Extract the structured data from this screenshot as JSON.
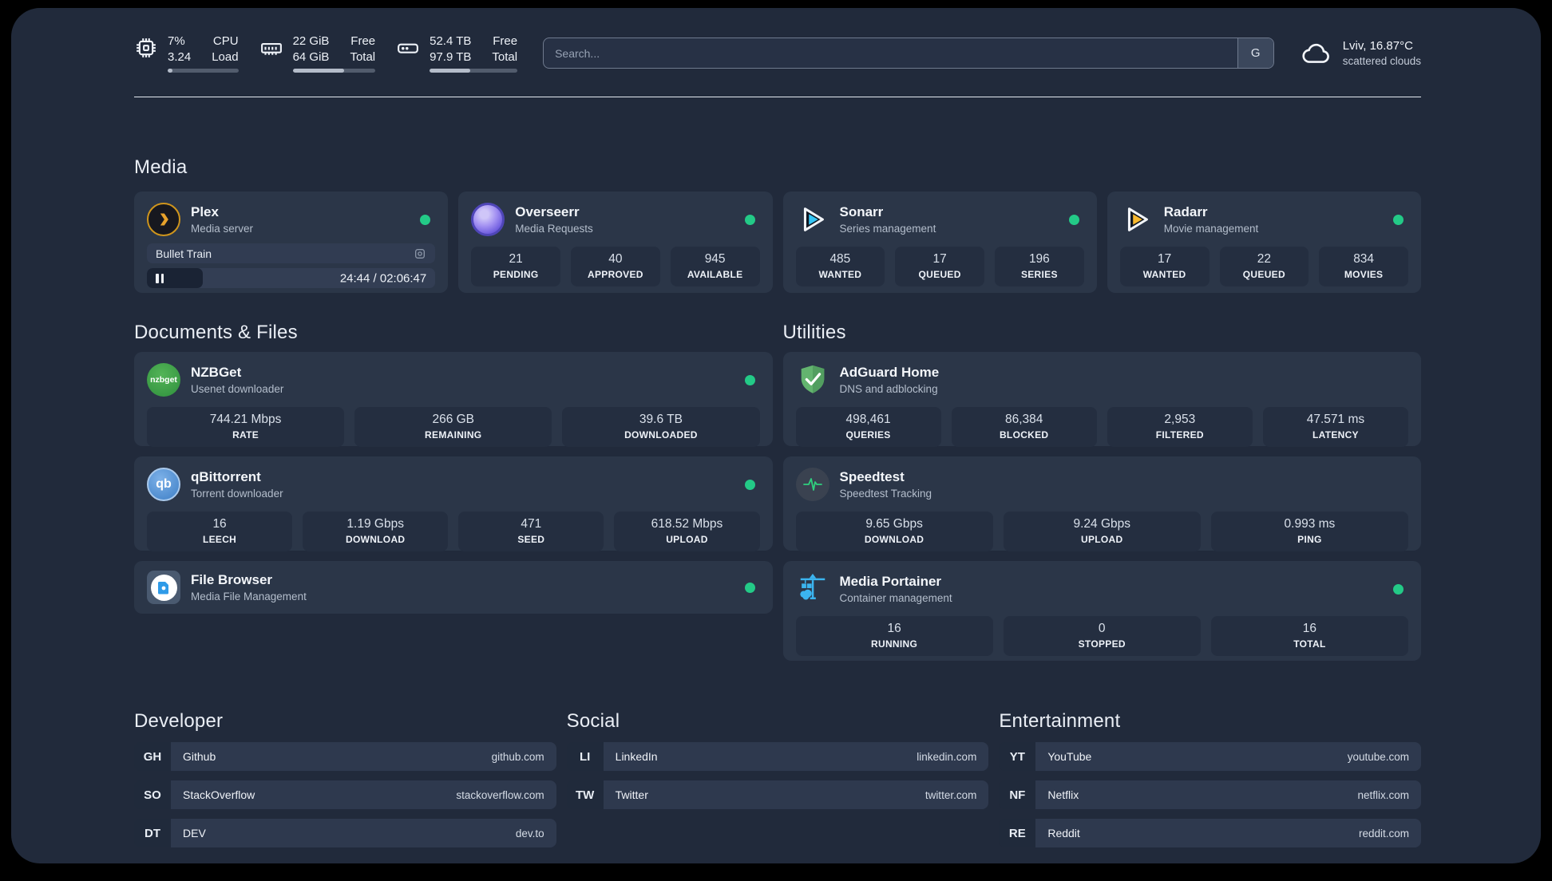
{
  "colors": {
    "status_online": "#23ca87",
    "background": "#212a3b",
    "card": "#2b3648"
  },
  "header": {
    "stats": [
      {
        "icon": "cpu-icon",
        "value_top": "7%",
        "value_bottom": "3.24",
        "label_top": "CPU",
        "label_bottom": "Load",
        "progress_pct": 7
      },
      {
        "icon": "memory-icon",
        "value_top": "22 GiB",
        "value_bottom": "64 GiB",
        "label_top": "Free",
        "label_bottom": "Total",
        "progress_pct": 62
      },
      {
        "icon": "storage-icon",
        "value_top": "52.4 TB",
        "value_bottom": "97.9 TB",
        "label_top": "Free",
        "label_bottom": "Total",
        "progress_pct": 46
      }
    ],
    "search": {
      "placeholder": "Search...",
      "button_label": "G"
    },
    "weather": {
      "icon": "cloud-icon",
      "location": "Lviv, 16.87°C",
      "condition": "scattered clouds"
    }
  },
  "media": {
    "title": "Media",
    "plex": {
      "name": "Plex",
      "description": "Media server",
      "online": true,
      "now_playing": {
        "title": "Bullet Train",
        "time_display": "24:44 / 02:06:47",
        "progress_pct": 19.5
      }
    },
    "overseerr": {
      "name": "Overseerr",
      "description": "Media Requests",
      "online": true,
      "stats": [
        {
          "value": "21",
          "label": "PENDING"
        },
        {
          "value": "40",
          "label": "APPROVED"
        },
        {
          "value": "945",
          "label": "AVAILABLE"
        }
      ]
    },
    "sonarr": {
      "name": "Sonarr",
      "description": "Series management",
      "online": true,
      "stats": [
        {
          "value": "485",
          "label": "WANTED"
        },
        {
          "value": "17",
          "label": "QUEUED"
        },
        {
          "value": "196",
          "label": "SERIES"
        }
      ]
    },
    "radarr": {
      "name": "Radarr",
      "description": "Movie management",
      "online": true,
      "stats": [
        {
          "value": "17",
          "label": "WANTED"
        },
        {
          "value": "22",
          "label": "QUEUED"
        },
        {
          "value": "834",
          "label": "MOVIES"
        }
      ]
    }
  },
  "documents": {
    "title": "Documents & Files",
    "nzbget": {
      "name": "NZBGet",
      "description": "Usenet downloader",
      "online": true,
      "icon_text": "nzbget",
      "stats": [
        {
          "value": "744.21 Mbps",
          "label": "RATE"
        },
        {
          "value": "266 GB",
          "label": "REMAINING"
        },
        {
          "value": "39.6 TB",
          "label": "DOWNLOADED"
        }
      ]
    },
    "qbittorrent": {
      "name": "qBittorrent",
      "description": "Torrent downloader",
      "online": true,
      "icon_text": "qb",
      "stats": [
        {
          "value": "16",
          "label": "LEECH"
        },
        {
          "value": "1.19 Gbps",
          "label": "DOWNLOAD"
        },
        {
          "value": "471",
          "label": "SEED"
        },
        {
          "value": "618.52 Mbps",
          "label": "UPLOAD"
        }
      ]
    },
    "filebrowser": {
      "name": "File Browser",
      "description": "Media File Management",
      "online": true
    }
  },
  "utilities": {
    "title": "Utilities",
    "adguard": {
      "name": "AdGuard Home",
      "description": "DNS and adblocking",
      "online": false,
      "stats": [
        {
          "value": "498,461",
          "label": "QUERIES"
        },
        {
          "value": "86,384",
          "label": "BLOCKED"
        },
        {
          "value": "2,953",
          "label": "FILTERED"
        },
        {
          "value": "47.571 ms",
          "label": "LATENCY"
        }
      ]
    },
    "speedtest": {
      "name": "Speedtest",
      "description": "Speedtest Tracking",
      "online": false,
      "stats": [
        {
          "value": "9.65 Gbps",
          "label": "DOWNLOAD"
        },
        {
          "value": "9.24 Gbps",
          "label": "UPLOAD"
        },
        {
          "value": "0.993 ms",
          "label": "PING"
        }
      ]
    },
    "portainer": {
      "name": "Media Portainer",
      "description": "Container management",
      "online": true,
      "stats": [
        {
          "value": "16",
          "label": "RUNNING"
        },
        {
          "value": "0",
          "label": "STOPPED"
        },
        {
          "value": "16",
          "label": "TOTAL"
        }
      ]
    }
  },
  "bookmarks": {
    "developer": {
      "title": "Developer",
      "links": [
        {
          "abbr": "GH",
          "name": "Github",
          "url": "github.com"
        },
        {
          "abbr": "SO",
          "name": "StackOverflow",
          "url": "stackoverflow.com"
        },
        {
          "abbr": "DT",
          "name": "DEV",
          "url": "dev.to"
        }
      ]
    },
    "social": {
      "title": "Social",
      "links": [
        {
          "abbr": "LI",
          "name": "LinkedIn",
          "url": "linkedin.com"
        },
        {
          "abbr": "TW",
          "name": "Twitter",
          "url": "twitter.com"
        }
      ]
    },
    "entertainment": {
      "title": "Entertainment",
      "links": [
        {
          "abbr": "YT",
          "name": "YouTube",
          "url": "youtube.com"
        },
        {
          "abbr": "NF",
          "name": "Netflix",
          "url": "netflix.com"
        },
        {
          "abbr": "RE",
          "name": "Reddit",
          "url": "reddit.com"
        }
      ]
    }
  }
}
